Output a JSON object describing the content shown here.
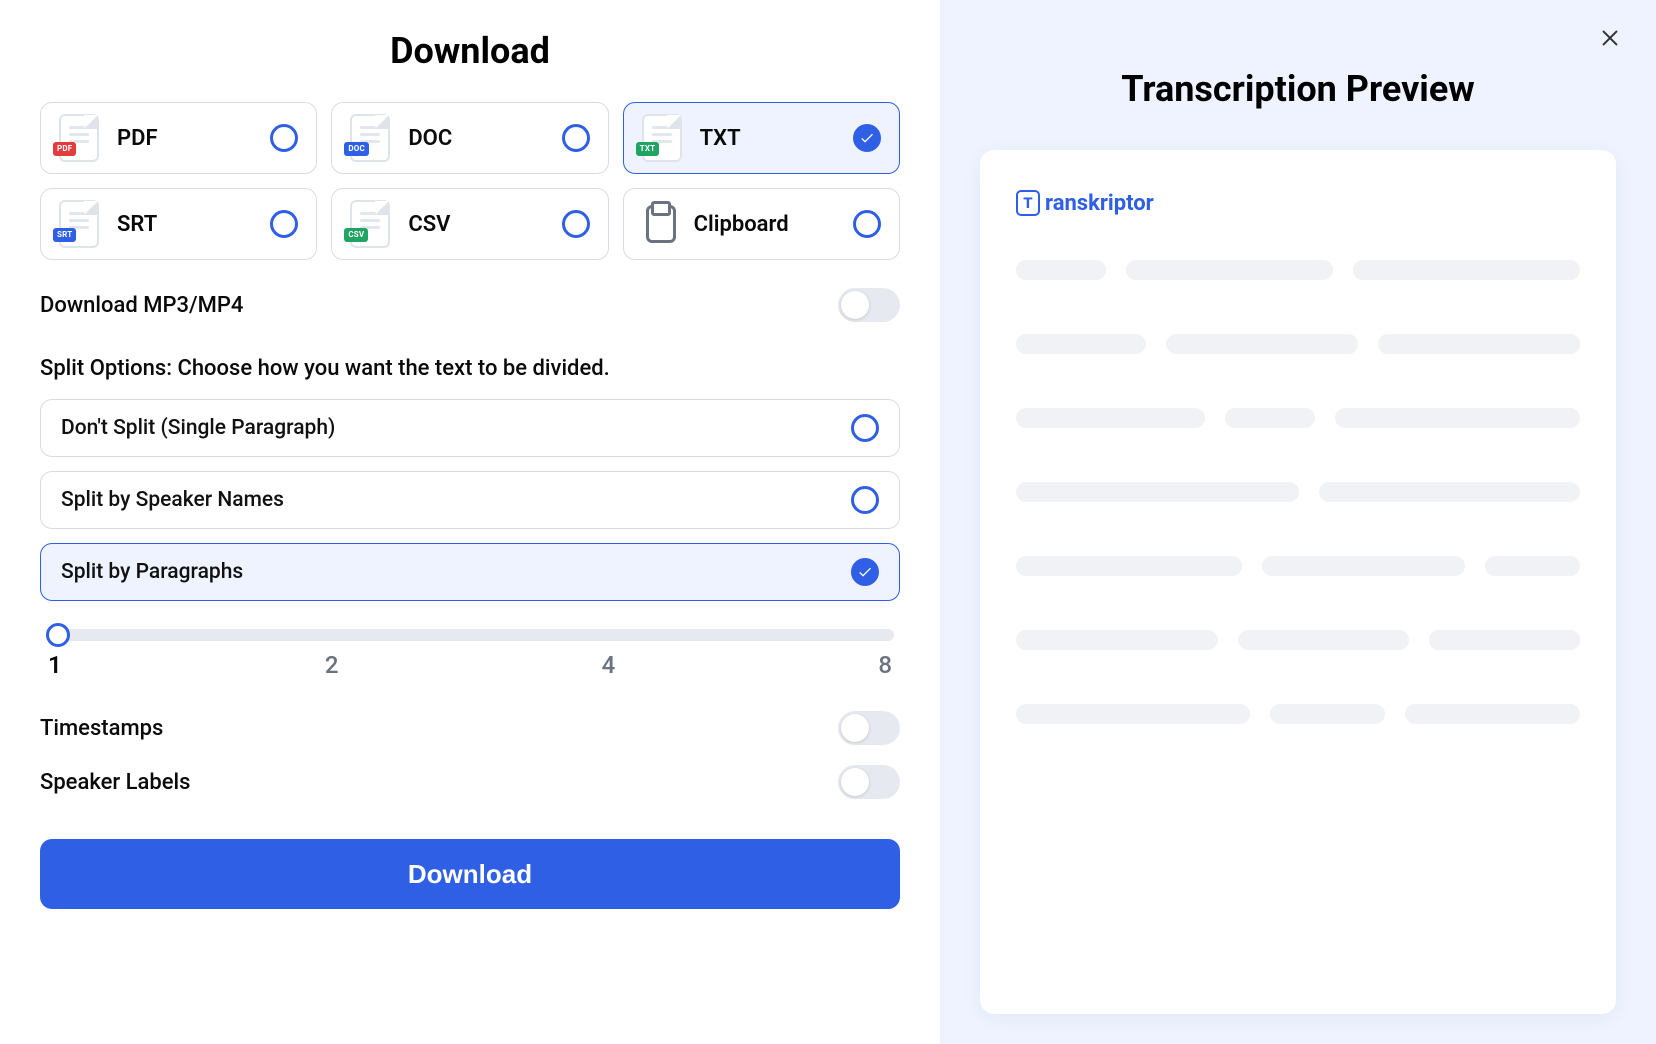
{
  "title": "Download",
  "formats": [
    {
      "key": "pdf",
      "label": "PDF",
      "tag_class": "pdf",
      "selected": false
    },
    {
      "key": "doc",
      "label": "DOC",
      "tag_class": "doc",
      "selected": false
    },
    {
      "key": "txt",
      "label": "TXT",
      "tag_class": "txt",
      "selected": true
    },
    {
      "key": "srt",
      "label": "SRT",
      "tag_class": "srt",
      "selected": false
    },
    {
      "key": "csv",
      "label": "CSV",
      "tag_class": "csv",
      "selected": false
    },
    {
      "key": "clipboard",
      "label": "Clipboard",
      "is_clipboard": true,
      "selected": false
    }
  ],
  "download_media_label": "Download MP3/MP4",
  "download_media_on": false,
  "split_heading": "Split Options: Choose how you want the text to be divided.",
  "split_options": [
    {
      "key": "nosplit",
      "label": "Don't Split (Single Paragraph)",
      "selected": false
    },
    {
      "key": "speaker",
      "label": "Split by Speaker Names",
      "selected": false
    },
    {
      "key": "para",
      "label": "Split by Paragraphs",
      "selected": true
    }
  ],
  "slider": {
    "value": 1,
    "marks": [
      "1",
      "2",
      "4",
      "8"
    ]
  },
  "timestamps_label": "Timestamps",
  "timestamps_on": false,
  "speaker_labels_label": "Speaker Labels",
  "speaker_labels_on": false,
  "download_button": "Download",
  "preview_title": "Transcription Preview",
  "brand_name": "ranskriptor",
  "brand_initial": "T"
}
